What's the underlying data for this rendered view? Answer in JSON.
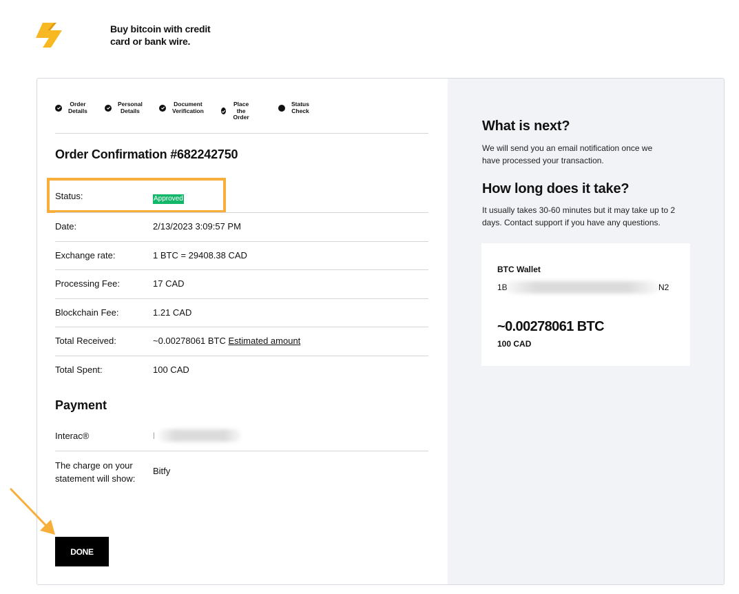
{
  "header": {
    "logo_icon": "bolt-logo-icon",
    "tagline": "Buy bitcoin with credit card or bank wire."
  },
  "steps": [
    {
      "label": "Order\nDetails",
      "state": "done"
    },
    {
      "label": "Personal\nDetails",
      "state": "done"
    },
    {
      "label": "Document\nVerification",
      "state": "done"
    },
    {
      "label": "Place\nthe Order",
      "state": "done"
    },
    {
      "label": "Status\nCheck",
      "state": "current"
    }
  ],
  "order": {
    "title": "Order Confirmation #682242750",
    "rows": {
      "status": {
        "label": "Status:",
        "value": "Approved"
      },
      "date": {
        "label": "Date:",
        "value": "2/13/2023 3:09:57 PM"
      },
      "rate": {
        "label": "Exchange rate:",
        "value": "1 BTC = 29408.38 CAD"
      },
      "processing": {
        "label": "Processing Fee:",
        "value": "17 CAD"
      },
      "blockchain": {
        "label": "Blockchain Fee:",
        "value": "1.21 CAD"
      },
      "received": {
        "label": "Total Received:",
        "value": "~0.00278061 BTC",
        "link": "Estimated amount"
      },
      "spent": {
        "label": "Total Spent:",
        "value": "100 CAD"
      }
    }
  },
  "payment": {
    "title": "Payment",
    "method_label": "Interac®",
    "method_value_visible": "l",
    "charge_label": "The charge on your statement will show:",
    "charge_value": "Bitfy"
  },
  "done_label": "DONE",
  "sidebar": {
    "next_title": "What is next?",
    "next_text": "We will send you an email notification once we have processed your transaction.",
    "long_title": "How long does it take?",
    "long_text": "It usually takes 30-60 minutes but it may take up to 2 days. Contact support if you have any questions.",
    "wallet_label": "BTC Wallet",
    "wallet_start": "1B",
    "wallet_end": "N2",
    "btc_amount": "~0.00278061 BTC",
    "cad_amount": "100 CAD"
  },
  "colors": {
    "accent": "#f7ae3a",
    "approved": "#12b76a",
    "sidebar_bg": "#f2f3f7",
    "button_bg": "#000000"
  }
}
